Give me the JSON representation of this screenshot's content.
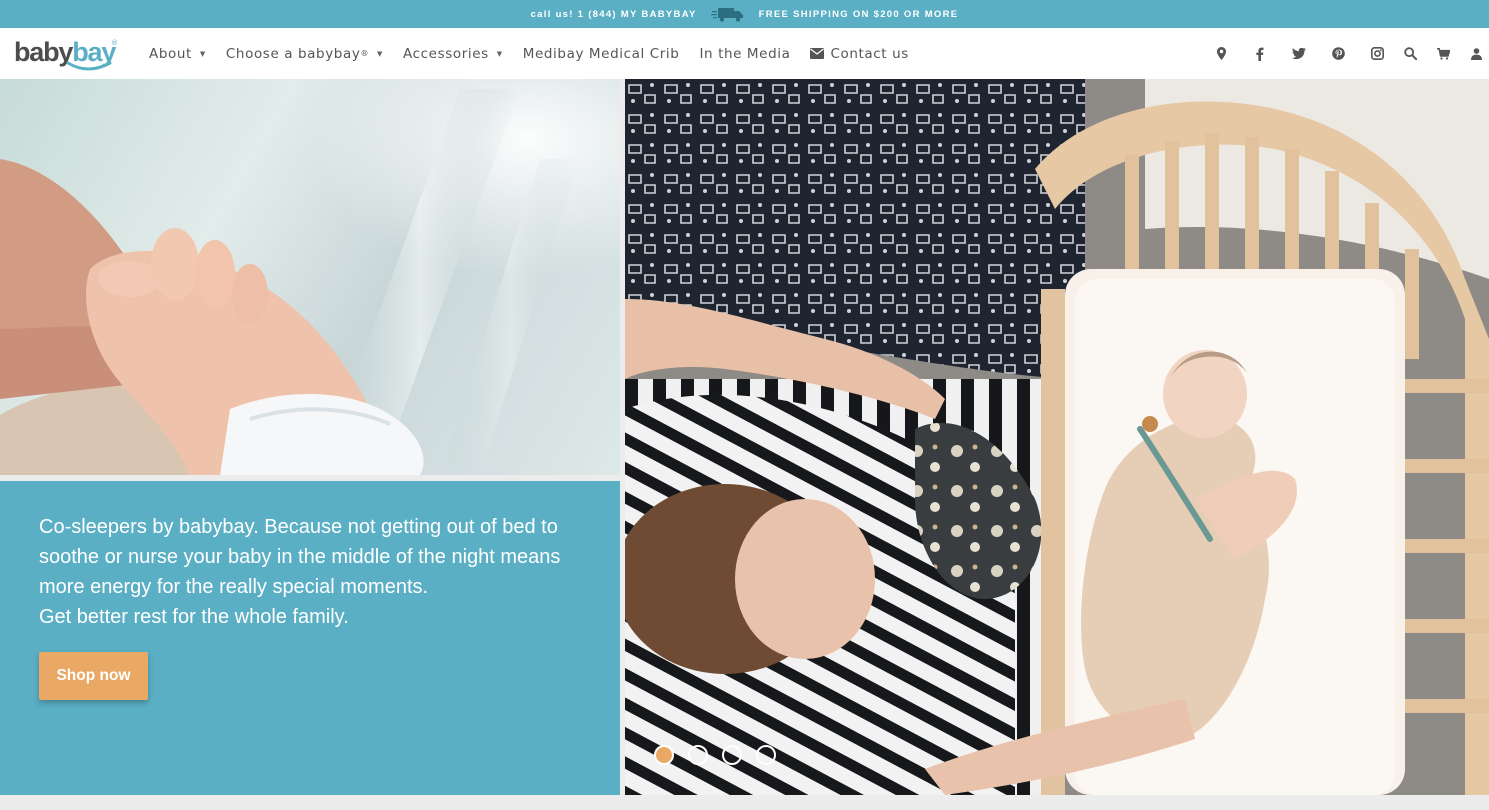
{
  "topbar": {
    "call": "call us! 1 (844) MY BABYBAY",
    "shipping": "FREE SHIPPING ON $200 OR MORE",
    "truck_icon": "truck-icon",
    "bg_color": "#5aafc5"
  },
  "logo": {
    "word_a": "baby",
    "word_b": "bay",
    "reg": "®"
  },
  "nav": {
    "items": [
      {
        "label": "About",
        "caret": "▼"
      },
      {
        "label": "Choose a babybay",
        "reg": "®",
        "caret": "▼"
      },
      {
        "label": "Accessories",
        "caret": "▼"
      },
      {
        "label": "Medibay Medical Crib"
      },
      {
        "label": "In the Media"
      },
      {
        "label": "Contact us",
        "icon": "envelope-icon"
      }
    ],
    "icons": [
      "map-pin-icon",
      "facebook-icon",
      "twitter-icon",
      "pinterest-icon",
      "instagram-icon",
      "search-icon",
      "cart-icon",
      "user-icon"
    ]
  },
  "hero": {
    "text_line1": "Co-sleepers by babybay. Because not getting out of bed to soothe or nurse your baby in the middle of the night means more energy for the really special moments.",
    "text_line2": "Get better rest for the whole family.",
    "button": "Shop now",
    "slides": 4,
    "active_slide": 1,
    "accent_color": "#e9a863"
  }
}
